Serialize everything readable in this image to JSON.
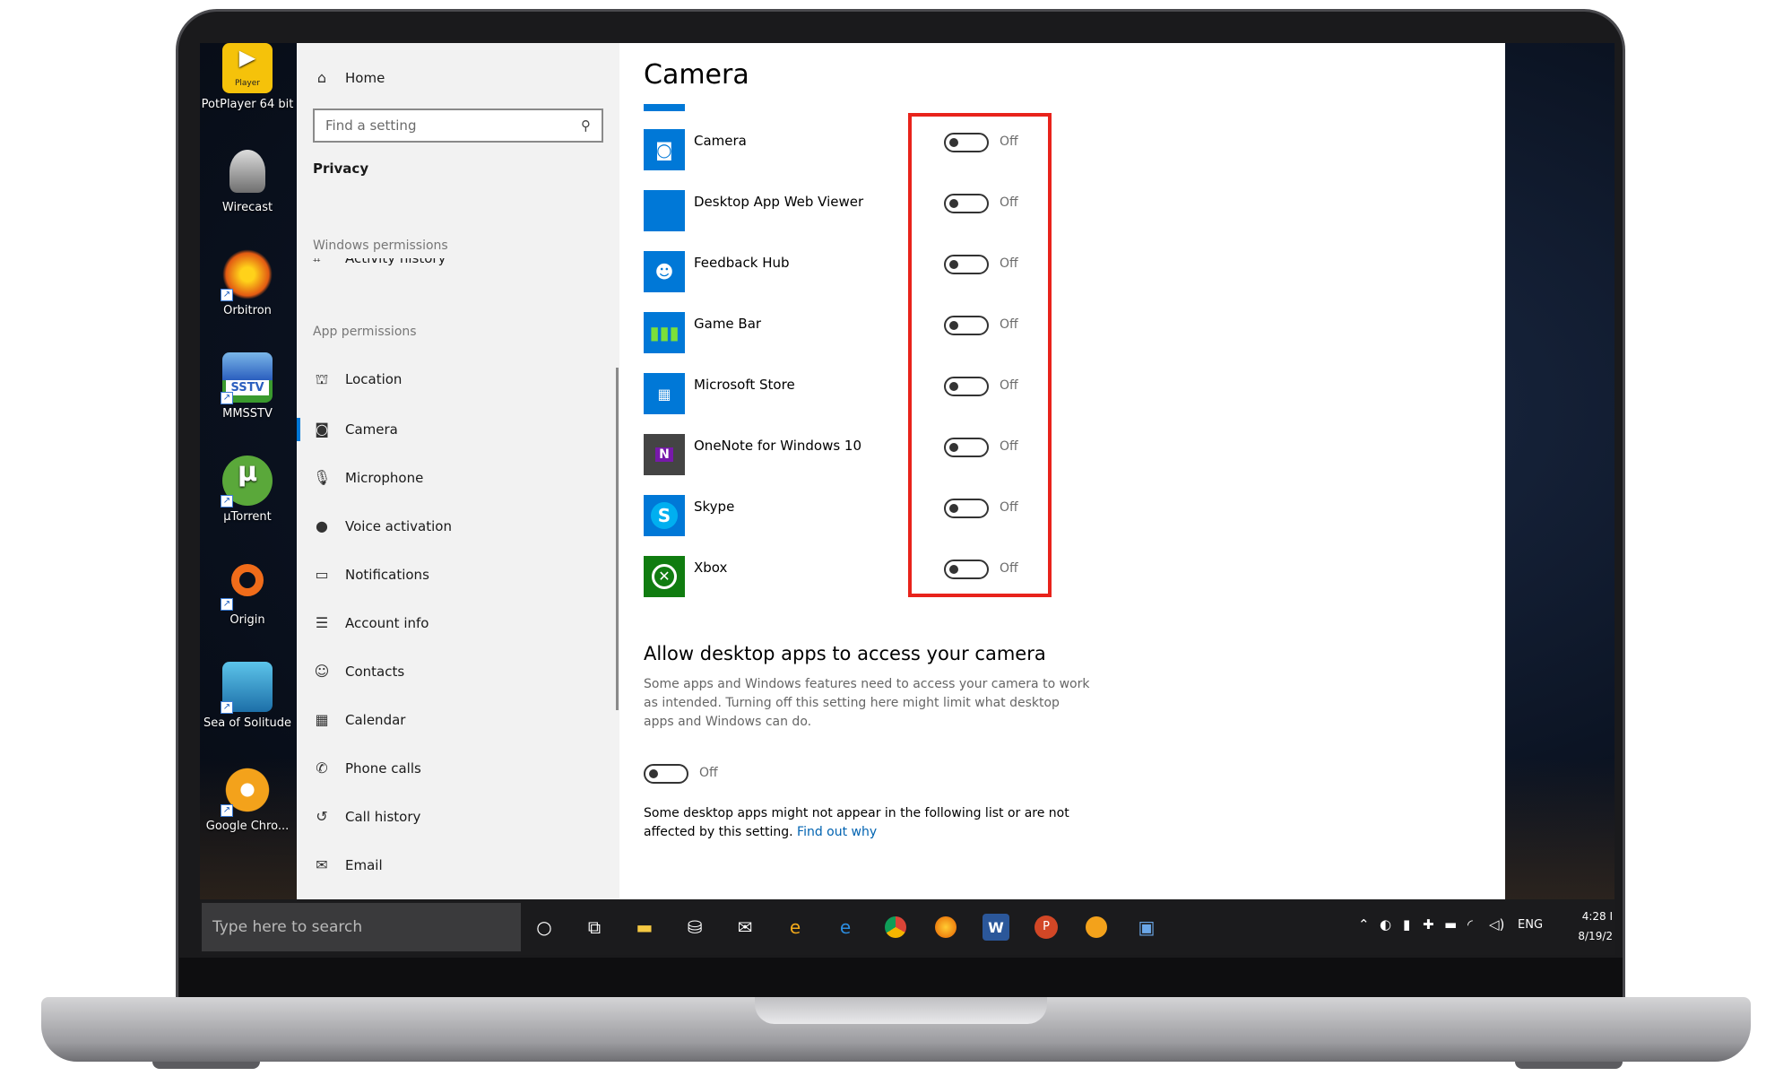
{
  "desktop": {
    "icons": [
      {
        "label": "PotPlayer 64 bit",
        "badge": "Player",
        "color": "#f5c20a"
      },
      {
        "label": "Wirecast",
        "color": "#8a8a8a"
      },
      {
        "label": "Orbitron",
        "color": "#e25a12"
      },
      {
        "label": "MMSSTV",
        "badge": "SSTV",
        "color": "#2b5fbf"
      },
      {
        "label": "µTorrent",
        "color": "#5aa83a"
      },
      {
        "label": "Origin",
        "color": "#f06c1a"
      },
      {
        "label": "Sea of Solitude",
        "color": "#1d6fa8"
      },
      {
        "label": "Google Chro...",
        "color": "#f3a21b"
      }
    ]
  },
  "sidebar": {
    "home": "Home",
    "search_placeholder": "Find a setting",
    "category": "Privacy",
    "windows_permissions": "Windows permissions",
    "partial_item": "Activity history",
    "app_permissions": "App permissions",
    "items": [
      {
        "label": "Location",
        "icon": "location-icon"
      },
      {
        "label": "Camera",
        "icon": "camera-icon",
        "selected": true
      },
      {
        "label": "Microphone",
        "icon": "microphone-icon"
      },
      {
        "label": "Voice activation",
        "icon": "voice-activation-icon"
      },
      {
        "label": "Notifications",
        "icon": "notifications-icon"
      },
      {
        "label": "Account info",
        "icon": "account-info-icon"
      },
      {
        "label": "Contacts",
        "icon": "contacts-icon"
      },
      {
        "label": "Calendar",
        "icon": "calendar-icon"
      },
      {
        "label": "Phone calls",
        "icon": "phone-calls-icon"
      },
      {
        "label": "Call history",
        "icon": "call-history-icon"
      },
      {
        "label": "Email",
        "icon": "email-icon"
      }
    ]
  },
  "content": {
    "title": "Camera",
    "apps": [
      {
        "name": "Camera",
        "state": "Off",
        "tile_color": "#0078d7",
        "icon": "camera-app-icon"
      },
      {
        "name": "Desktop App Web Viewer",
        "state": "Off",
        "tile_color": "#0078d7",
        "icon": "web-viewer-icon"
      },
      {
        "name": "Feedback Hub",
        "state": "Off",
        "tile_color": "#0078d7",
        "icon": "feedback-hub-icon"
      },
      {
        "name": "Game Bar",
        "state": "Off",
        "tile_color": "#0078d7",
        "icon": "game-bar-icon"
      },
      {
        "name": "Microsoft Store",
        "state": "Off",
        "tile_color": "#0078d7",
        "icon": "store-icon"
      },
      {
        "name": "OneNote for Windows 10",
        "state": "Off",
        "tile_color": "#444444",
        "icon": "onenote-icon"
      },
      {
        "name": "Skype",
        "state": "Off",
        "tile_color": "#0078d7",
        "icon": "skype-icon"
      },
      {
        "name": "Xbox",
        "state": "Off",
        "tile_color": "#107c10",
        "icon": "xbox-icon"
      }
    ],
    "desktop_heading": "Allow desktop apps to access your camera",
    "desktop_desc": "Some apps and Windows features need to access your camera to work as intended. Turning off this setting here might limit what desktop apps and Windows can do.",
    "desktop_toggle_state": "Off",
    "note_text": "Some desktop apps might not appear in the following list or are not affected by this setting. ",
    "note_link": "Find out why"
  },
  "taskbar": {
    "search_placeholder": "Type here to search",
    "language": "ENG",
    "time": "4:28 I",
    "date": "8/19/2"
  },
  "colors": {
    "accent": "#0078d7",
    "highlight_box": "#e8231b",
    "link": "#0063b1"
  }
}
